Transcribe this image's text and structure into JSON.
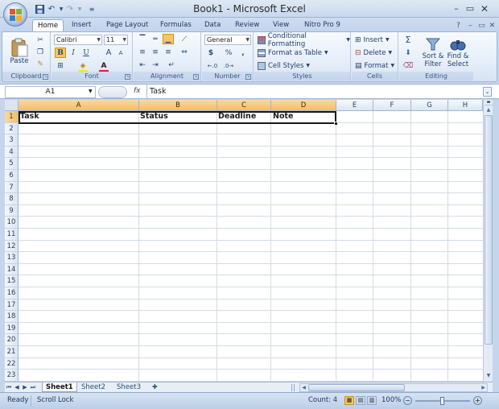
{
  "window": {
    "title": "Book1 - Microsoft Excel"
  },
  "tabs": [
    "Home",
    "Insert",
    "Page Layout",
    "Formulas",
    "Data",
    "Review",
    "View",
    "Nitro Pro 9"
  ],
  "ribbon": {
    "clipboard": {
      "label": "Clipboard",
      "paste": "Paste"
    },
    "font": {
      "label": "Font",
      "name": "Calibri",
      "size": "11",
      "bold": "B",
      "italic": "I",
      "underline": "U",
      "grow": "A",
      "shrink": "A"
    },
    "alignment": {
      "label": "Alignment"
    },
    "number": {
      "label": "Number",
      "format": "General",
      "currency": "$",
      "percent": "%",
      "comma": ","
    },
    "styles": {
      "label": "Styles",
      "conditional": "Conditional Formatting",
      "format_table": "Format as Table",
      "cell_styles": "Cell Styles"
    },
    "cells": {
      "label": "Cells",
      "insert": "Insert",
      "delete": "Delete",
      "format": "Format"
    },
    "editing": {
      "label": "Editing",
      "sum": "Σ",
      "sort_1": "Sort &",
      "sort_2": "Filter",
      "find_1": "Find &",
      "find_2": "Select"
    }
  },
  "formula_bar": {
    "name_box": "A1",
    "fx": "fx",
    "value": "Task"
  },
  "grid": {
    "columns": [
      "A",
      "B",
      "C",
      "D",
      "E",
      "F",
      "G",
      "H"
    ],
    "rows": [
      "1",
      "2",
      "3",
      "4",
      "5",
      "6",
      "7",
      "8",
      "9",
      "10",
      "11",
      "12",
      "13",
      "14",
      "15",
      "16",
      "17",
      "18",
      "19",
      "20",
      "21",
      "22",
      "23"
    ],
    "cells": {
      "A1": "Task",
      "B1": "Status",
      "C1": "Deadline",
      "D1": "Note"
    }
  },
  "sheets": [
    "Sheet1",
    "Sheet2",
    "Sheet3"
  ],
  "status": {
    "ready": "Ready",
    "scroll_lock": "Scroll Lock",
    "count": "Count: 4",
    "zoom": "100%"
  },
  "colors": {
    "accent": "#f1c15f",
    "ribbon": "#dfe9f5"
  }
}
